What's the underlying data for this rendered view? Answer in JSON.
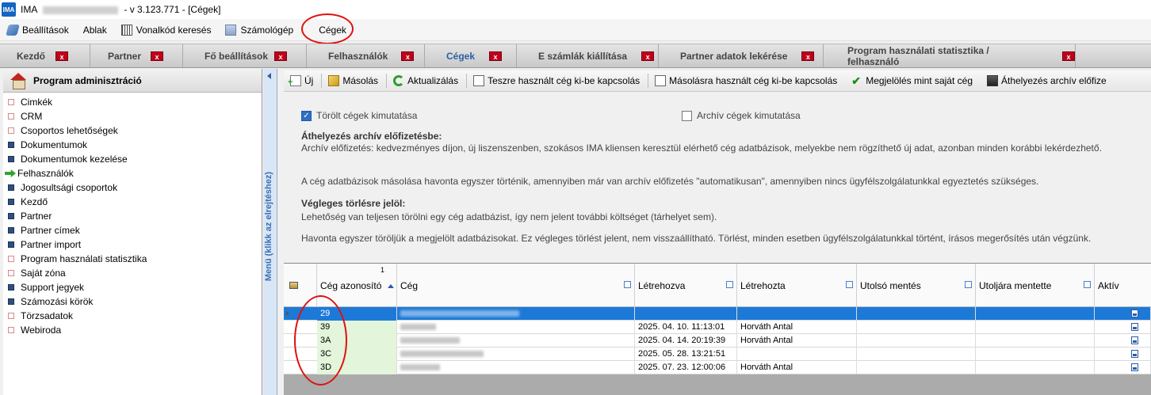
{
  "titlebar": {
    "app_icon": "IMA",
    "app_name": "IMA",
    "version": "- v 3.123.771 - [Cégek]"
  },
  "menu": [
    {
      "label": "Beállítások",
      "icon": "settings-icon"
    },
    {
      "label": "Ablak",
      "icon": ""
    },
    {
      "label": "Vonalkód keresés",
      "icon": "barcode-icon"
    },
    {
      "label": "Számológép",
      "icon": "calculator-icon"
    },
    {
      "label": "Cégek",
      "icon": ""
    }
  ],
  "tabs": [
    {
      "label": "Kezdő",
      "close": "x"
    },
    {
      "label": "Partner",
      "close": "x"
    },
    {
      "label": "Fő beállítások",
      "close": "x"
    },
    {
      "label": "Felhasználók",
      "close": "x"
    },
    {
      "label": "Cégek",
      "close": "x",
      "active": true
    },
    {
      "label": "E számlák kiállítása",
      "close": "x"
    },
    {
      "label": "Partner adatok lekérése",
      "close": "x"
    },
    {
      "label": "Program használati statisztika / felhasználó",
      "close": "x"
    }
  ],
  "sidebar": {
    "title": "Program adminisztráció",
    "collapse_label": "Menü (klikk az elrejtéshez)",
    "items": [
      {
        "label": "Cimkék",
        "bullet": "red"
      },
      {
        "label": "CRM",
        "bullet": "red"
      },
      {
        "label": "Csoportos lehetőségek",
        "bullet": "red"
      },
      {
        "label": "Dokumentumok",
        "bullet": "blue"
      },
      {
        "label": "Dokumentumok kezelése",
        "bullet": "blue"
      },
      {
        "label": "Felhasználók",
        "bullet": "arrow"
      },
      {
        "label": "Jogosultsági csoportok",
        "bullet": "blue"
      },
      {
        "label": "Kezdő",
        "bullet": "blue"
      },
      {
        "label": "Partner",
        "bullet": "blue"
      },
      {
        "label": "Partner címek",
        "bullet": "blue"
      },
      {
        "label": "Partner import",
        "bullet": "blue"
      },
      {
        "label": "Program használati statisztika",
        "bullet": "red"
      },
      {
        "label": "Saját zóna",
        "bullet": "red"
      },
      {
        "label": "Support jegyek",
        "bullet": "blue"
      },
      {
        "label": "Számozási körök",
        "bullet": "blue"
      },
      {
        "label": "Törzsadatok",
        "bullet": "red"
      },
      {
        "label": "Webiroda",
        "bullet": "red"
      }
    ]
  },
  "toolbar": [
    {
      "label": "Új",
      "icon": "new-icon"
    },
    {
      "label": "Másolás",
      "icon": "copy-icon"
    },
    {
      "label": "Aktualizálás",
      "icon": "refresh-icon"
    },
    {
      "label": "Teszre használt cég ki-be kapcsolás",
      "icon": "document-icon"
    },
    {
      "label": "Másolásra használt cég ki-be kapcsolás",
      "icon": "document-icon"
    },
    {
      "label": "Megjelölés mint saját cég",
      "icon": "check-icon"
    },
    {
      "label": "Áthelyezés archív előfize",
      "icon": "archive-icon"
    }
  ],
  "options": {
    "deleted": {
      "label": "Törölt cégek kimutatása",
      "checked": true
    },
    "archived": {
      "label": "Archív cégek kimutatása",
      "checked": false
    }
  },
  "info": {
    "heading1": "Áthelyezés archív előfizetésbe:",
    "text1": "Archív előfizetés: kedvezményes díjon, új liszenszenben, szokásos IMA kliensen keresztül elérhető cég adatbázisok, melyekbe nem rögzíthető új adat, azonban minden korábbi lekérdezhető.",
    "text2": "A cég adatbázisok másolása havonta egyszer történik, amennyiben már van archív előfizetés \"automatikusan\", amennyiben nincs ügyfélszolgálatunkkal egyeztetés szükséges.",
    "heading2": "Végleges törlésre jelöl:",
    "text3": "Lehetőség van teljesen törölni egy cég adatbázist, így nem jelent további költséget (tárhelyet sem).",
    "text4": "Havonta egyszer töröljük a megjelölt adatbázisokat. Ez végleges törlést jelent, nem visszaállítható. Törlést, minden esetben ügyfélszolgálatunkkal történt, írásos megerősítés után végzünk."
  },
  "grid": {
    "sort_index": "1",
    "columns": [
      "Cég azonosító",
      "Cég",
      "Létrehozva",
      "Létrehozta",
      "Utolsó mentés",
      "Utoljára mentette",
      "Aktív"
    ],
    "rows": [
      {
        "id": "29",
        "created": "",
        "creator": "",
        "last_saved": "",
        "last_saver": "",
        "selected": true
      },
      {
        "id": "39",
        "created": "2025. 04. 10. 11:13:01",
        "creator": "Horváth Antal",
        "last_saved": "",
        "last_saver": ""
      },
      {
        "id": "3A",
        "created": "2025. 04. 14. 20:19:39",
        "creator": "Horváth Antal",
        "last_saved": "",
        "last_saver": ""
      },
      {
        "id": "3C",
        "created": "2025. 05. 28. 13:21:51",
        "creator": "",
        "last_saved": "",
        "last_saver": ""
      },
      {
        "id": "3D",
        "created": "2025. 07. 23. 12:00:06",
        "creator": "Horváth Antal",
        "last_saved": "",
        "last_saver": ""
      }
    ]
  },
  "colors": {
    "accent": "#1c79d8",
    "annotation": "#e01010",
    "tab_close": "#c0001a"
  }
}
